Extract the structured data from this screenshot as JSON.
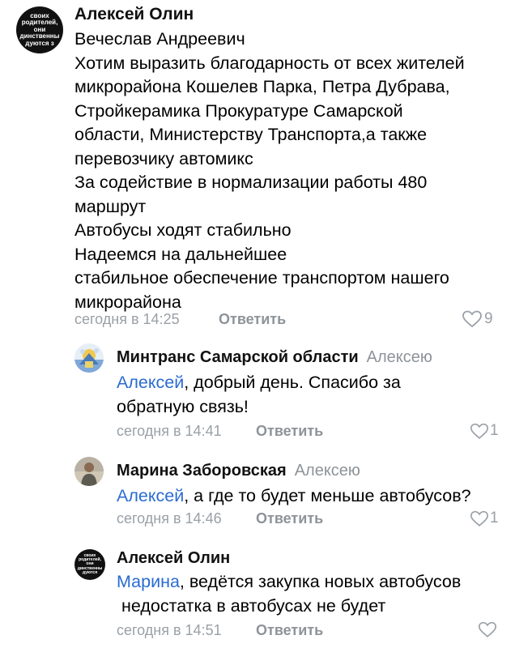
{
  "comments": [
    {
      "author": "Алексей Олин",
      "avatar_lines": [
        "своих",
        "родителей,",
        "они",
        "динственны",
        "дуются з"
      ],
      "lines": [
        "Вечеслав Андреевич",
        "Хотим выразить благодарность от всех жителей",
        "микрорайона Кошелев Парка, Петра Дубрава,",
        "Стройкерамика Прокуратуре Самарской",
        "области, Министерству Транспорта,а также",
        "перевозчику автомикс",
        "За содействие в нормализации работы 480",
        "маршрут",
        "Автобусы ходят стабильно",
        "Надеемся на дальнейшее",
        "стабильное обеспечение транспортом нашего",
        "микрорайона"
      ],
      "time": "сегодня в 14:25",
      "reply_label": "Ответить",
      "likes": "9"
    }
  ],
  "replies": [
    {
      "author": "Минтранс Самарской области",
      "reply_to": "Алексею",
      "mention": "Алексей",
      "lines": [
        ", добрый день. Спасибо за",
        "обратную связь!"
      ],
      "time": "сегодня в 14:41",
      "reply_label": "Ответить",
      "likes": "1"
    },
    {
      "author": "Марина Заборовская",
      "reply_to": "Алексею",
      "mention": "Алексей",
      "lines": [
        ", а где то будет меньше автобусов?"
      ],
      "time": "сегодня в 14:46",
      "reply_label": "Ответить",
      "likes": "1"
    },
    {
      "author": "Алексей Олин",
      "avatar_lines": [
        "своих",
        "родителей,",
        "они",
        "динственны",
        "дуются"
      ],
      "mention": "Марина",
      "lines": [
        ", ведётся закупка новых автобусов",
        " недостатка в автобусах не будет"
      ],
      "time": "сегодня в 14:51",
      "reply_label": "Ответить",
      "likes": ""
    }
  ],
  "colors": {
    "mention": "#2a6bd1",
    "meta": "#9aa0a6",
    "avatar_dark": "#111111"
  }
}
